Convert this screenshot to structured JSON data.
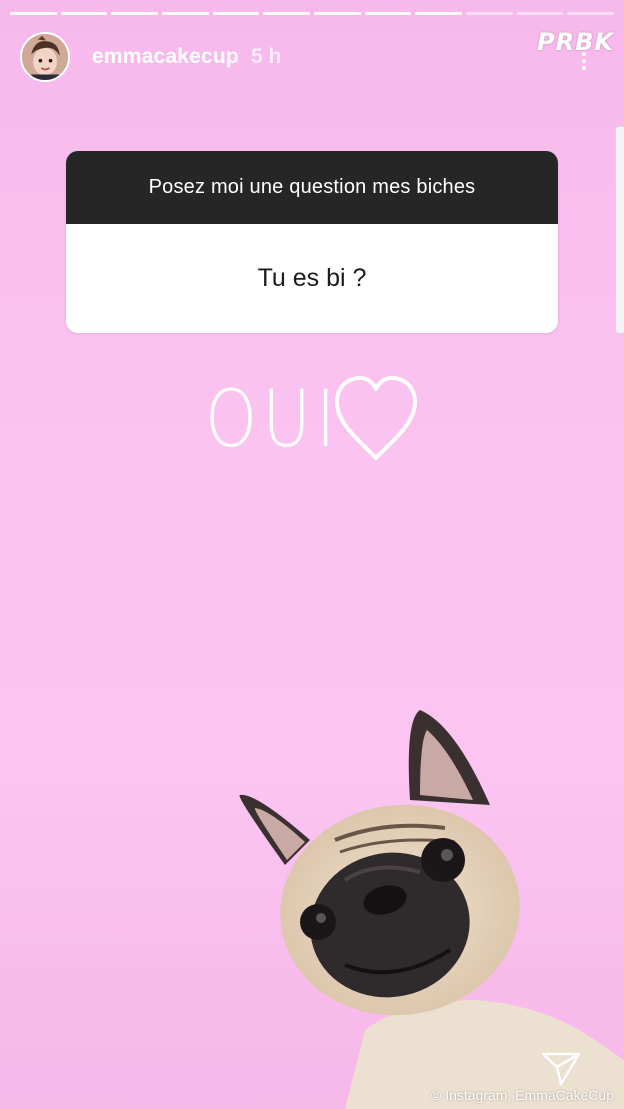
{
  "story": {
    "progress_total": 12,
    "progress_done": 9
  },
  "header": {
    "username": "emmacakecup",
    "time": "5 h"
  },
  "watermark": "PRBK",
  "question_sticker": {
    "prompt": "Posez moi une question mes biches",
    "question": "Tu es bi ?"
  },
  "answer": {
    "text": "OUI",
    "icon": "heart-outline-icon"
  },
  "credit": "© Instagram, EmmaCakeCup",
  "colors": {
    "background": "#f9c0ef",
    "sticker_header": "#262626",
    "sticker_body": "#ffffff"
  }
}
